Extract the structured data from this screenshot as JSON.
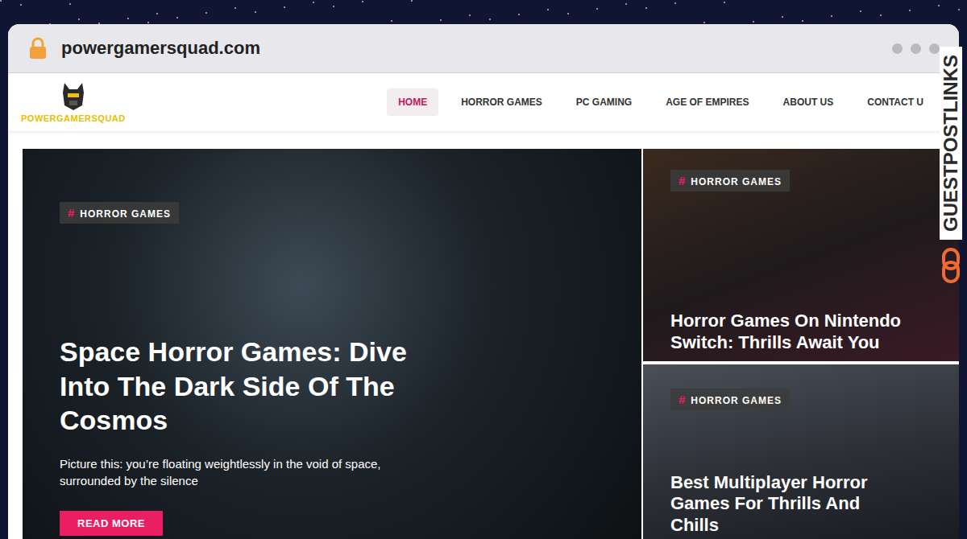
{
  "browser": {
    "url": "powergamersquad.com"
  },
  "site": {
    "logo_text": "POWERGAMERSQUAD",
    "nav": [
      {
        "label": "HOME",
        "selected": true
      },
      {
        "label": "HORROR GAMES",
        "selected": false
      },
      {
        "label": "PC GAMING",
        "selected": false
      },
      {
        "label": "AGE OF EMPIRES",
        "selected": false
      },
      {
        "label": "ABOUT US",
        "selected": false
      },
      {
        "label": "CONTACT U",
        "selected": false
      }
    ]
  },
  "hero": {
    "tag_icon": "#",
    "tag": "HORROR GAMES",
    "title": "Space Horror Games: Dive Into The Dark Side Of The Cosmos",
    "excerpt": "Picture this: you’re floating weightlessly in the void of space, surrounded by the silence",
    "button": "READ MORE"
  },
  "side_posts": [
    {
      "tag_icon": "#",
      "tag": "HORROR GAMES",
      "title": "Horror Games On Nintendo Switch: Thrills Await You"
    },
    {
      "tag_icon": "#",
      "tag": "HORROR GAMES",
      "title": "Best Multiplayer Horror Games For Thrills And Chills"
    }
  ],
  "watermark": "GUESTPOSTLINKS"
}
